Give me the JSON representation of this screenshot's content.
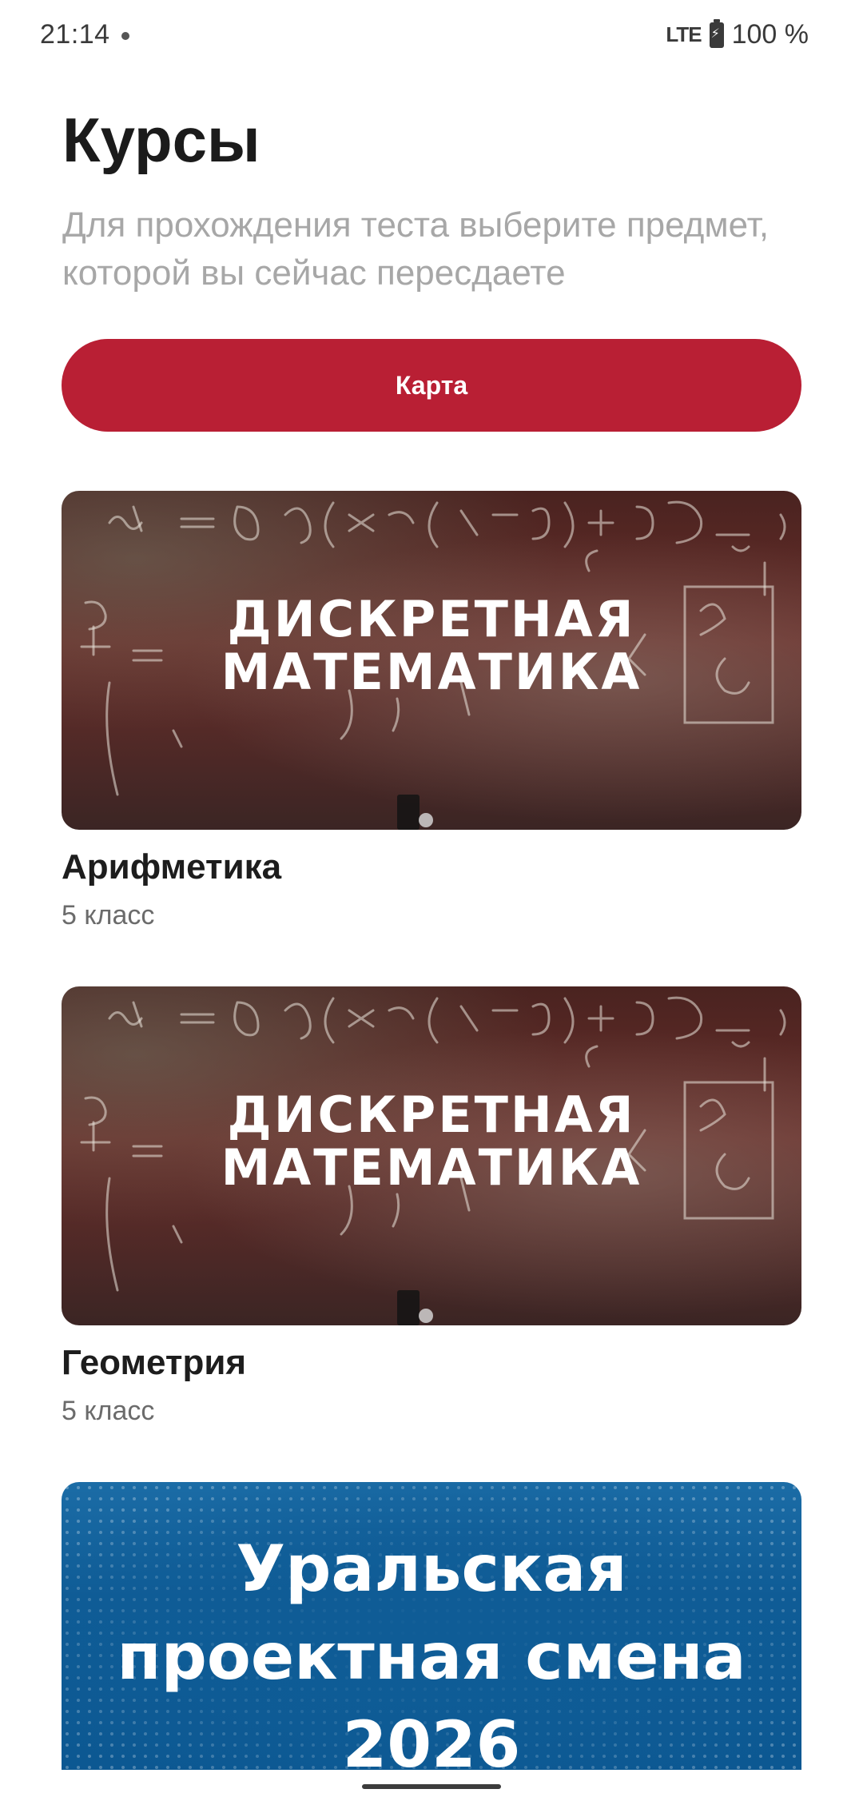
{
  "status_bar": {
    "time": "21:14",
    "network": "LTE",
    "battery": "100 %"
  },
  "header": {
    "title": "Курсы",
    "subtitle": "Для прохождения теста выберите предмет, которой вы сейчас пересдаете"
  },
  "map_button": {
    "label": "Карта"
  },
  "courses": [
    {
      "image_title_line1": "ДИСКРЕТНАЯ",
      "image_title_line2": "МАТЕМАТИКА",
      "name": "Арифметика",
      "grade": "5 класс"
    },
    {
      "image_title_line1": "ДИСКРЕТНАЯ",
      "image_title_line2": "МАТЕМАТИКА",
      "name": "Геометрия",
      "grade": "5 класс"
    }
  ],
  "banner": {
    "line1": "Уральская",
    "line2": "проектная смена",
    "line3": "2026"
  },
  "colors": {
    "accent": "#b91f34",
    "banner_blue": "#0f5c96",
    "subtitle_gray": "#a7a7a7"
  }
}
